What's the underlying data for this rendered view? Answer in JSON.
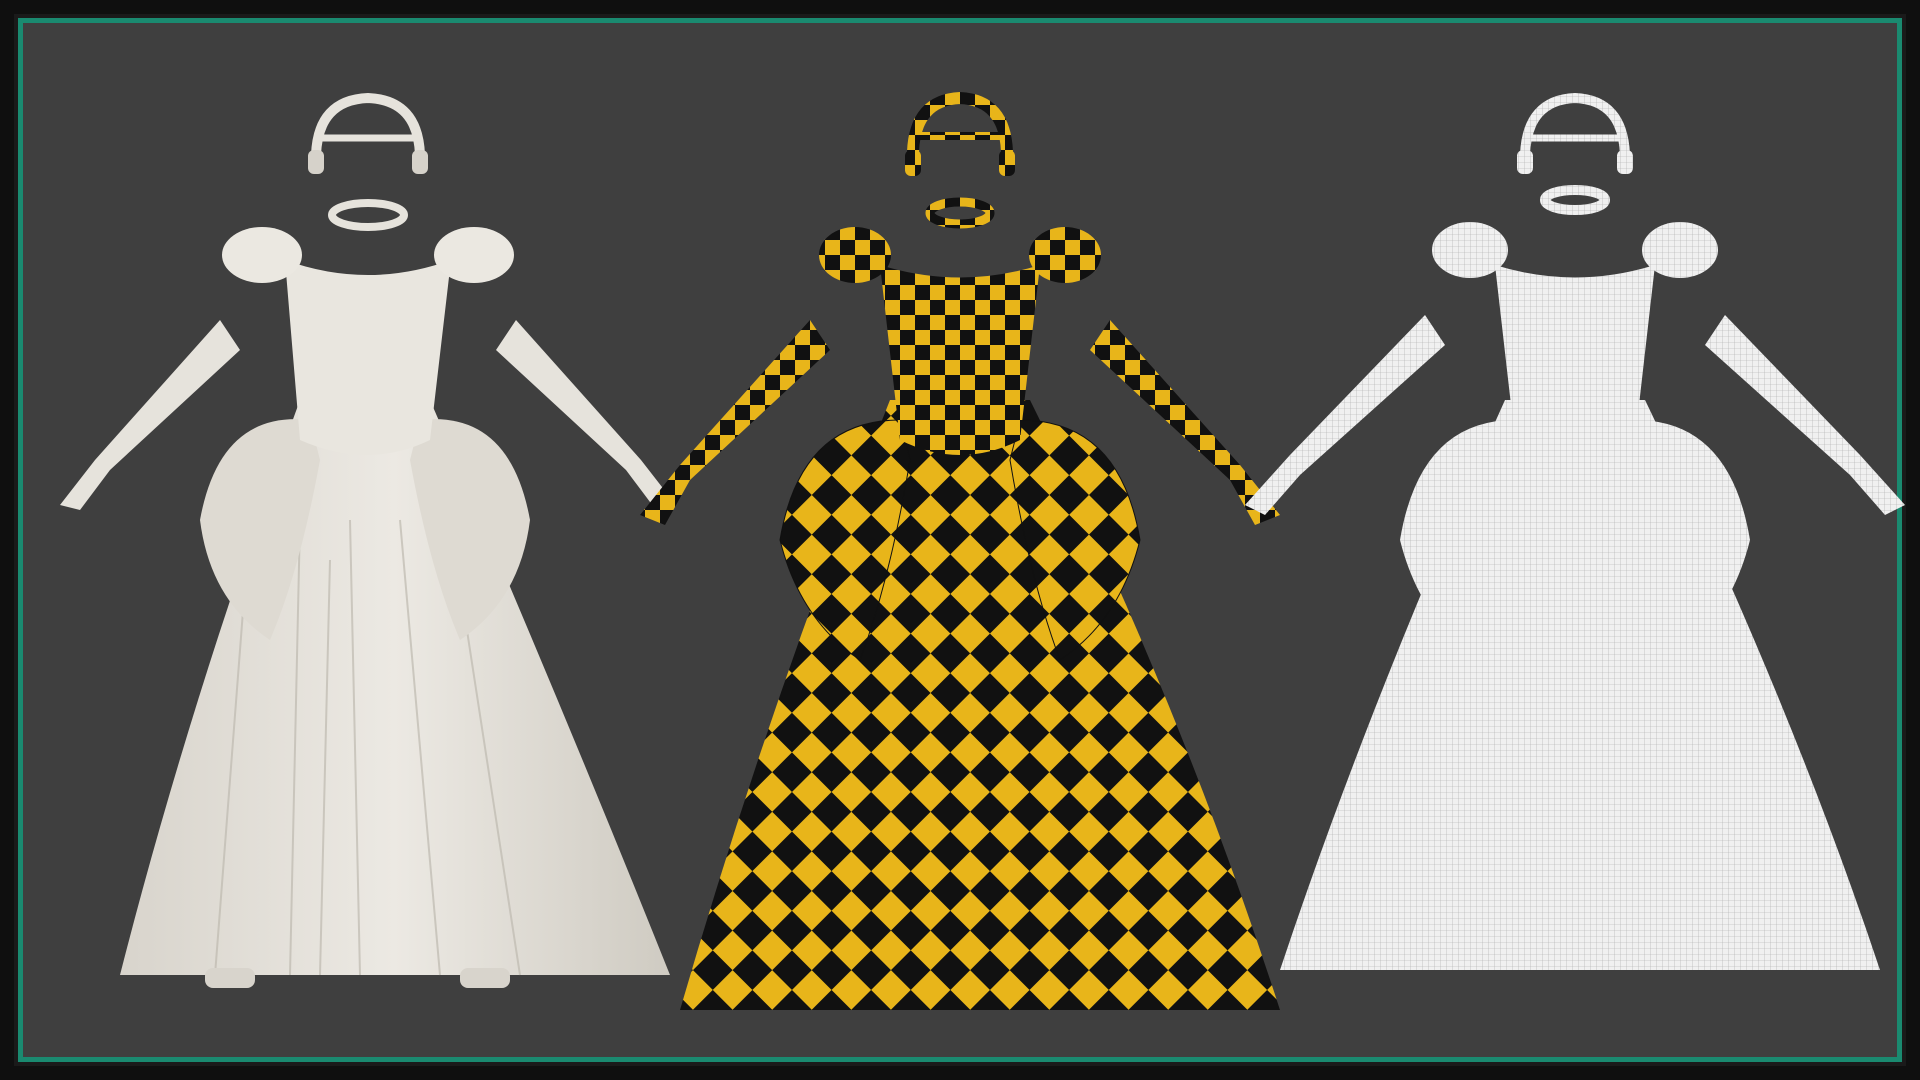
{
  "colors": {
    "background": "#3f3f3f",
    "frame_outer": "#0f0f0f",
    "frame_accent": "#1a8a70",
    "white_fabric": "#e6e3dc",
    "white_fabric_shade": "#c9c5bc",
    "checker_yellow": "#e8b51a",
    "checker_black": "#111111",
    "wire_white": "#f2f2f2",
    "wire_line": "#9a9a9a"
  },
  "scene": {
    "models": [
      {
        "variant": "solid-white-render"
      },
      {
        "variant": "yellow-black-checker-uv"
      },
      {
        "variant": "white-wireframe"
      }
    ],
    "garment_parts": [
      "headband",
      "choker",
      "dress-with-puff-sleeves",
      "left-opera-glove",
      "right-opera-glove"
    ]
  }
}
